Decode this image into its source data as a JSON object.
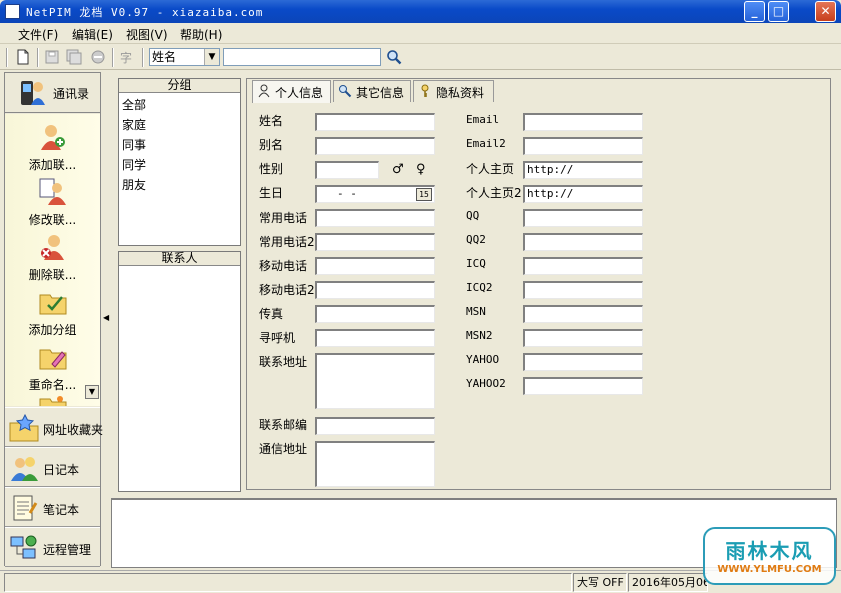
{
  "window": {
    "title": "NetPIM 龙档  V0.97 - xiazaiba.com",
    "minimize": "_",
    "maximize": "□",
    "close": "✕"
  },
  "menu": [
    "文件(F)",
    "编辑(E)",
    "视图(V)",
    "帮助(H)"
  ],
  "toolbar": {
    "font_label": "字",
    "search_field": {
      "selected": "姓名"
    },
    "search_value": ""
  },
  "nav": {
    "header": "通讯录",
    "actions": [
      "添加联...",
      "修改联...",
      "删除联...",
      "添加分组",
      "重命名..."
    ],
    "scroll_down": "▼",
    "categories": [
      "网址收藏夹",
      "日记本",
      "笔记本",
      "远程管理"
    ]
  },
  "groups": {
    "title": "分组",
    "items": [
      "全部",
      "家庭",
      "同事",
      "同学",
      "朋友"
    ]
  },
  "contacts": {
    "title": "联系人"
  },
  "tabs": [
    "个人信息",
    "其它信息",
    "隐私资料"
  ],
  "form_left": {
    "name": "姓名",
    "alias": "别名",
    "gender": "性别",
    "male_symbol": "♂",
    "female_symbol": "♀",
    "birthday": "生日",
    "birthday_value": " -  - ",
    "calendar_btn": "15",
    "phone": "常用电话",
    "phone2": "常用电话2",
    "mobile": "移动电话",
    "mobile2": "移动电话2",
    "fax": "传真",
    "pager": "寻呼机",
    "address": "联系地址",
    "postcode": "联系邮编",
    "mail_address": "通信地址"
  },
  "form_right": {
    "email": "Email",
    "email2": "Email2",
    "homepage": "个人主页",
    "homepage2": "个人主页2",
    "homepage_value": "http://",
    "homepage2_value": "http://",
    "qq": "QQ",
    "qq2": "QQ2",
    "icq": "ICQ",
    "icq2": "ICQ2",
    "msn": "MSN",
    "msn2": "MSN2",
    "yahoo": "YAHOO",
    "yahoo2": "YAHOO2"
  },
  "status": {
    "caps": "大写 OFF",
    "date": "2016年05月06"
  },
  "watermark": {
    "top": "雨林木风",
    "bottom": "WWW.YLMFU.COM"
  }
}
